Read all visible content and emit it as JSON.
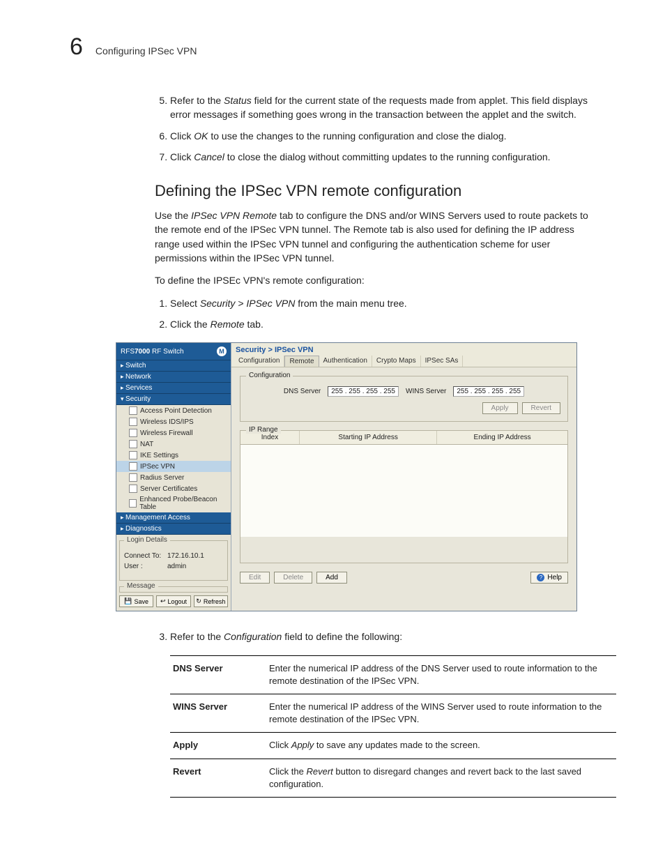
{
  "header": {
    "chapter_number": "6",
    "chapter_title": "Configuring IPSec VPN"
  },
  "steps_pre": [
    {
      "n": "5.",
      "before": "Refer to the ",
      "em": "Status",
      "after": " field for the current state of the requests made from applet. This field displays error messages if something goes wrong in the transaction between the applet and the switch."
    },
    {
      "n": "6.",
      "before": "Click ",
      "em": "OK",
      "after": " to use the changes to the running configuration and close the dialog."
    },
    {
      "n": "7.",
      "before": "Click ",
      "em": "Cancel",
      "after": " to close the dialog without committing updates to the running configuration."
    }
  ],
  "heading": "Defining the IPSec VPN remote configuration",
  "intro": {
    "start": "Use the ",
    "em": "IPSec VPN Remote",
    "end": " tab to configure the DNS and/or WINS Servers used to route packets to the remote end of the IPSec VPN tunnel. The Remote tab is also used for defining the IP address range used within the IPSec VPN tunnel and configuring the authentication scheme for user permissions within the IPSec VPN tunnel."
  },
  "lead": "To define the IPSEc VPN's remote configuration:",
  "steps_main": [
    {
      "n": "1.",
      "before": "Select ",
      "em": "Security > IPSec VPN",
      "after": " from the main menu tree."
    },
    {
      "n": "2.",
      "before": "Click the ",
      "em": "Remote",
      "after": " tab."
    }
  ],
  "app": {
    "product_prefix": "RFS",
    "product_model": "7000",
    "product_suffix": " RF Switch",
    "logo_letter": "M",
    "nav": {
      "switch": "Switch",
      "network": "Network",
      "services": "Services",
      "security": "Security",
      "sec_items": [
        "Access Point Detection",
        "Wireless IDS/IPS",
        "Wireless Firewall",
        "NAT",
        "IKE Settings",
        "IPSec VPN",
        "Radius Server",
        "Server Certificates",
        "Enhanced Probe/Beacon Table"
      ],
      "management": "Management Access",
      "diagnostics": "Diagnostics"
    },
    "login": {
      "legend": "Login Details",
      "connect_label": "Connect To:",
      "connect_value": "172.16.10.1",
      "user_label": "User :",
      "user_value": "admin"
    },
    "message_legend": "Message",
    "sb_buttons": {
      "save": "Save",
      "logout": "Logout",
      "refresh": "Refresh"
    },
    "crumb": "Security > IPSec VPN",
    "tabs": [
      "Configuration",
      "Remote",
      "Authentication",
      "Crypto Maps",
      "IPSec SAs"
    ],
    "cfg": {
      "legend": "Configuration",
      "dns_label": "DNS Server",
      "dns_value": "255 . 255 . 255 . 255",
      "wins_label": "WINS Server",
      "wins_value": "255 . 255 . 255 . 255",
      "apply": "Apply",
      "revert": "Revert"
    },
    "iprange": {
      "legend": "IP Range",
      "col_index": "Index",
      "col_start": "Starting IP Address",
      "col_end": "Ending IP Address"
    },
    "buttons": {
      "edit": "Edit",
      "delete": "Delete",
      "add": "Add",
      "help": "Help"
    }
  },
  "step_after": {
    "n": "3.",
    "before": "Refer to the ",
    "em": "Configuration",
    "after": " field to define the following:"
  },
  "table": [
    {
      "term": "DNS Server",
      "desc": "Enter the numerical IP address of the DNS Server used to route information to the remote destination of the IPSec VPN."
    },
    {
      "term": "WINS Server",
      "desc": "Enter the numerical IP address of the WINS Server used to route information to the remote destination of the IPSec VPN."
    },
    {
      "term": "Apply",
      "desc_before": "Click ",
      "desc_em": "Apply",
      "desc_after": " to save any updates made to the screen."
    },
    {
      "term": "Revert",
      "desc_before": "Click the ",
      "desc_em": "Revert",
      "desc_after": " button to disregard changes and revert back to the last saved configuration."
    }
  ]
}
